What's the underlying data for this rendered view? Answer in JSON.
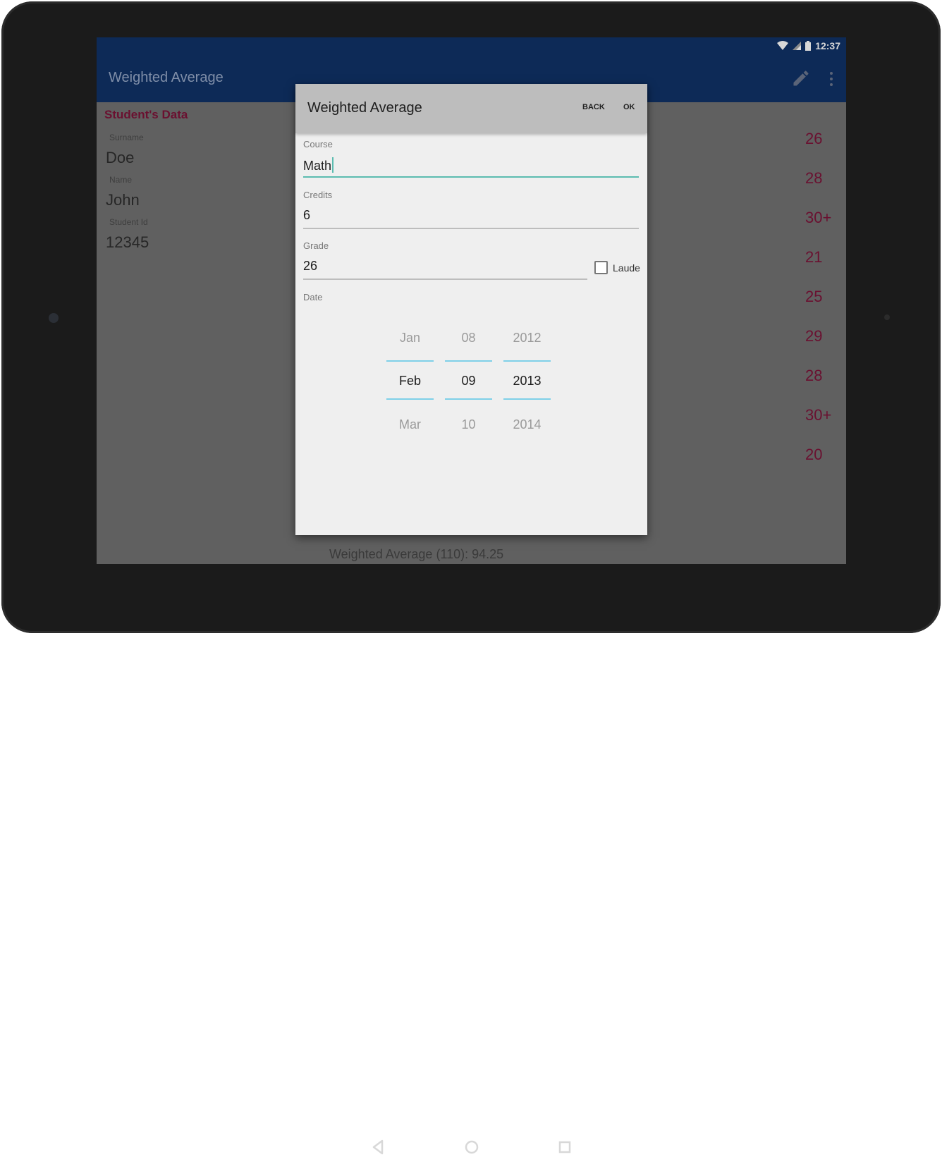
{
  "status_bar": {
    "time": "12:37"
  },
  "app_bar": {
    "title": "Weighted Average"
  },
  "student": {
    "section_title": "Student's Data",
    "surname_label": "Surname",
    "surname_value": "Doe",
    "name_label": "Name",
    "name_value": "John",
    "id_label": "Student Id",
    "id_value": "12345"
  },
  "grades": [
    "26",
    "28",
    "30+",
    "21",
    "25",
    "29",
    "28",
    "30+",
    "20"
  ],
  "background_summary": "Weighted Average (110): 94.25",
  "fab_label": "+",
  "dialog": {
    "title": "Weighted Average",
    "back_label": "BACK",
    "ok_label": "OK",
    "course_label": "Course",
    "course_value": "Math",
    "credits_label": "Credits",
    "credits_value": "6",
    "grade_label": "Grade",
    "grade_value": "26",
    "laude_label": "Laude",
    "laude_checked": false,
    "date_label": "Date",
    "date_picker": {
      "month": {
        "prev": "Jan",
        "current": "Feb",
        "next": "Mar"
      },
      "day": {
        "prev": "08",
        "current": "09",
        "next": "10"
      },
      "year": {
        "prev": "2012",
        "current": "2013",
        "next": "2014"
      }
    }
  },
  "colors": {
    "app_bar": "#0d2a57",
    "accent": "#7a0e32",
    "input_active": "#5bbcb0",
    "picker_divider": "#7fd0e8"
  },
  "icons": [
    "wifi-icon",
    "signal-icon",
    "battery-icon",
    "edit-icon",
    "more-vert-icon",
    "add-icon",
    "back-nav-icon",
    "home-nav-icon",
    "recents-nav-icon"
  ]
}
